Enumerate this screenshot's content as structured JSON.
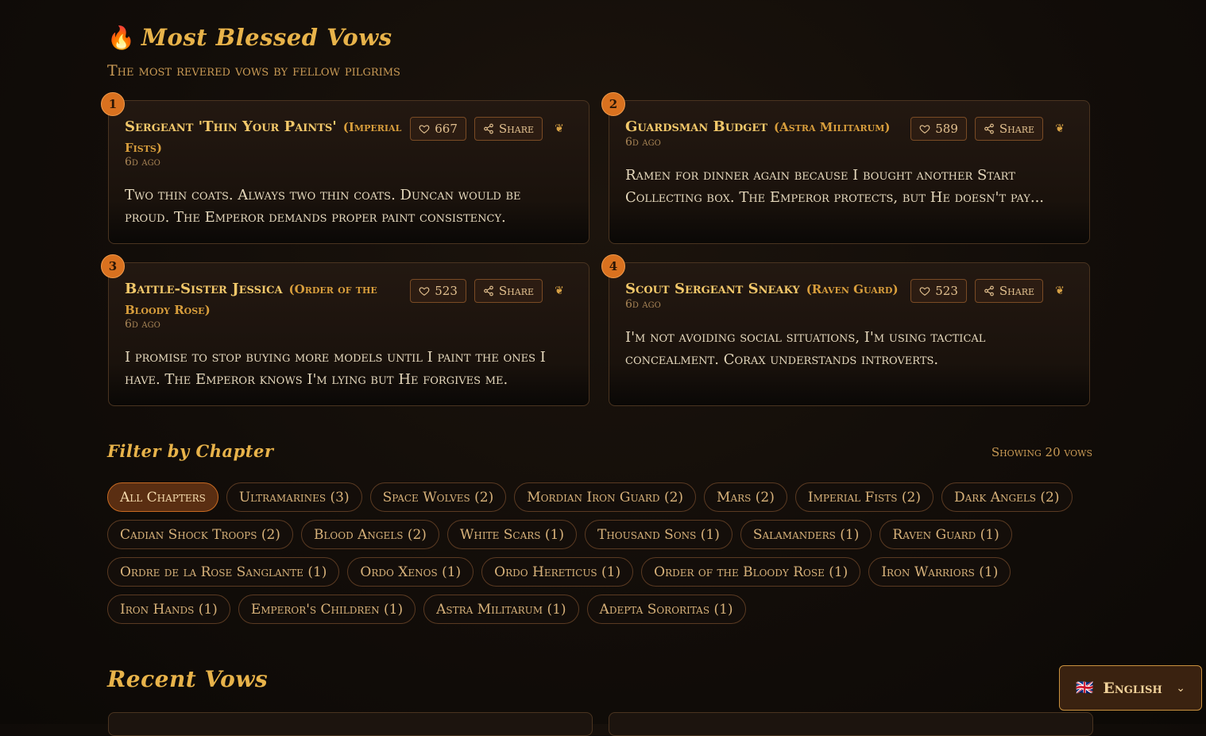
{
  "hero": {
    "title": "Most Blessed Vows",
    "subtitle": "The most revered vows by fellow pilgrims"
  },
  "top_vows": [
    {
      "rank": "1",
      "author": "Sergeant 'Thin Your Paints'",
      "chapter": "(Imperial Fists)",
      "time": "6d ago",
      "likes": "667",
      "share_label": "Share",
      "text": "Two thin coats. Always two thin coats. Duncan would be proud. The Emperor demands proper paint consistency."
    },
    {
      "rank": "2",
      "author": "Guardsman Budget",
      "chapter": "(Astra Militarum)",
      "time": "6d ago",
      "likes": "589",
      "share_label": "Share",
      "text": "Ramen for dinner again because I bought another Start Collecting box. The Emperor protects, but He doesn't pay..."
    },
    {
      "rank": "3",
      "author": "Battle-Sister Jessica",
      "chapter": "(Order of the Bloody Rose)",
      "time": "6d ago",
      "likes": "523",
      "share_label": "Share",
      "text": "I promise to stop buying more models until I paint the ones I have. The Emperor knows I'm lying but He forgives me."
    },
    {
      "rank": "4",
      "author": "Scout Sergeant Sneaky",
      "chapter": "(Raven Guard)",
      "time": "6d ago",
      "likes": "523",
      "share_label": "Share",
      "text": "I'm not avoiding social situations, I'm using tactical concealment. Corax understands introverts."
    }
  ],
  "filter": {
    "title": "Filter by Chapter",
    "showing": "Showing 20 vows",
    "chips": [
      "All Chapters",
      "Ultramarines (3)",
      "Space Wolves (2)",
      "Mordian Iron Guard (2)",
      "Mars (2)",
      "Imperial Fists (2)",
      "Dark Angels (2)",
      "Cadian Shock Troops (2)",
      "Blood Angels (2)",
      "White Scars (1)",
      "Thousand Sons (1)",
      "Salamanders (1)",
      "Raven Guard (1)",
      "Ordre de la Rose Sanglante (1)",
      "Ordo Xenos (1)",
      "Ordo Hereticus (1)",
      "Order of the Bloody Rose (1)",
      "Iron Warriors (1)",
      "Iron Hands (1)",
      "Emperor's Children (1)",
      "Astra Militarum (1)",
      "Adepta Sororitas (1)"
    ],
    "active_index": 0
  },
  "recent": {
    "title": "Recent Vows"
  },
  "language": {
    "flag": "🇬🇧",
    "label": "English"
  },
  "colors": {
    "accent": "#e8b34a",
    "rank_badge": "#d9711f",
    "background": "#120d09"
  }
}
